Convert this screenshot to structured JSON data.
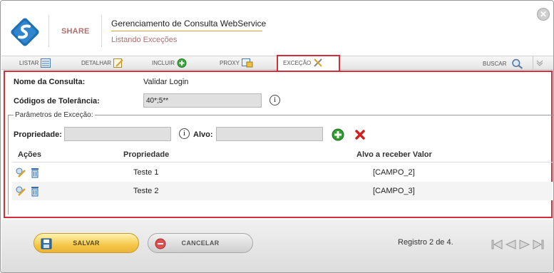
{
  "header": {
    "brand": "SHARE",
    "title": "Gerenciamento de Consulta WebService",
    "subtitle": "Listando Exceções",
    "close_symbol": "✕"
  },
  "toolbar": {
    "items": [
      {
        "label": "LISTAR",
        "icon": "list-icon"
      },
      {
        "label": "DETALHAR",
        "icon": "edit-icon"
      },
      {
        "label": "INCLUIR",
        "icon": "add-icon"
      },
      {
        "label": "PROXY",
        "icon": "proxy-icon"
      },
      {
        "label": "EXCEÇÃO",
        "icon": "tools-icon"
      }
    ],
    "search_label": "BUSCAR"
  },
  "form": {
    "nome_label": "Nome da Consulta:",
    "nome_value": "Validar Login",
    "codigos_label": "Códigos de Tolerância:",
    "codigos_value": "40*;5**",
    "info_symbol": "i"
  },
  "excecao": {
    "legend": "Parâmetros de Exceção:",
    "propriedade_label": "Propriedade:",
    "propriedade_value": "",
    "alvo_label": "Alvo:",
    "alvo_value": ""
  },
  "table": {
    "headers": [
      "Ações",
      "Propriedade",
      "Alvo a receber Valor"
    ],
    "rows": [
      {
        "propriedade": "Teste 1",
        "alvo": "[CAMPO_2]"
      },
      {
        "propriedade": "Teste 2",
        "alvo": "[CAMPO_3]"
      }
    ]
  },
  "footer": {
    "save_label": "SALVAR",
    "cancel_label": "CANCELAR",
    "record_text": "Registro 2 de 4."
  },
  "colors": {
    "accent_red": "#d22f3a",
    "accent_gold": "#e2a23a",
    "brand_blue": "#1f6fb5"
  }
}
